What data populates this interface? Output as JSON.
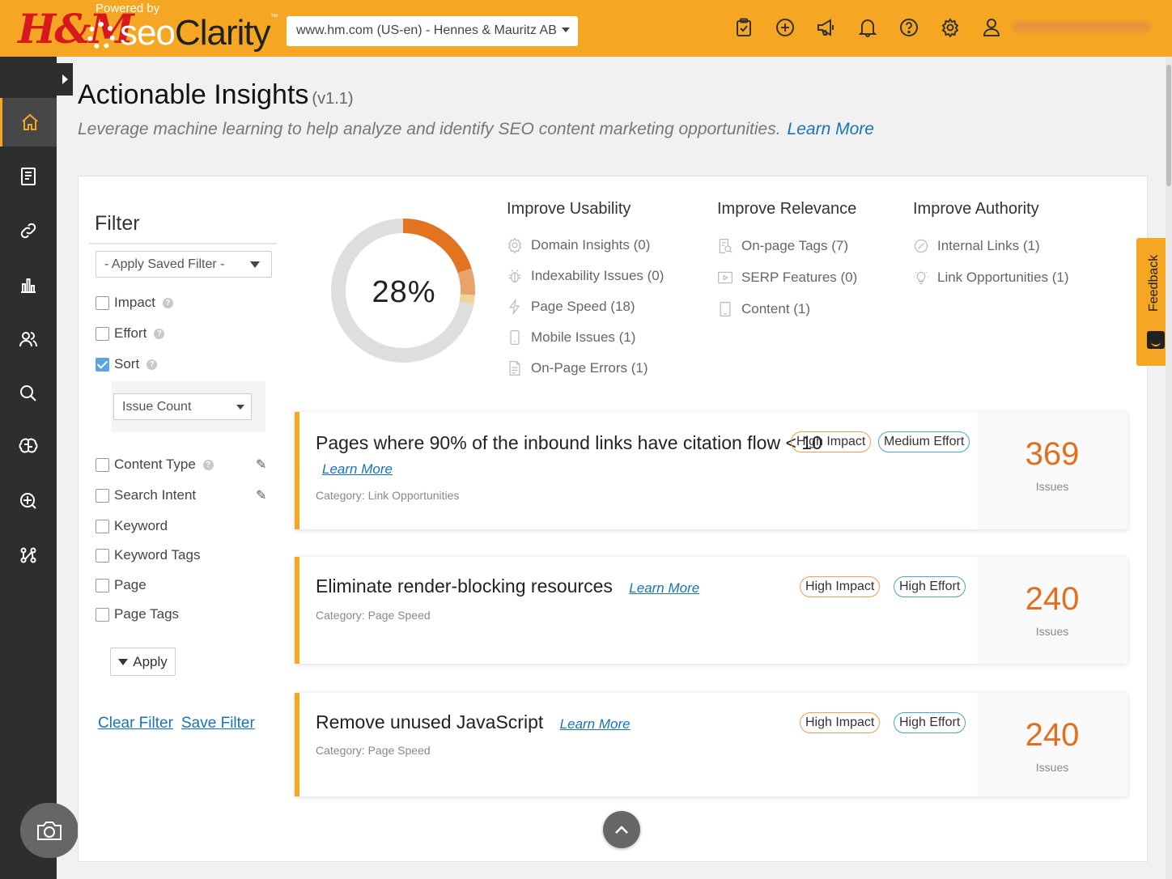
{
  "header": {
    "brand_logo": "H&M",
    "powered_by": "Powered by",
    "product_name_a": "seo",
    "product_name_b": "Clarity",
    "trademark": "™",
    "site_select": "www.hm.com (US-en) - Hennes & Mauritz AB",
    "icons": [
      "clipboard-check-icon",
      "plus-circle-icon",
      "megaphone-icon",
      "bell-icon",
      "help-circle-icon",
      "settings-icon",
      "user-icon"
    ]
  },
  "sidebar": {
    "items": [
      {
        "icon": "home-icon",
        "active": true
      },
      {
        "icon": "document-icon",
        "active": false
      },
      {
        "icon": "link-icon",
        "active": false
      },
      {
        "icon": "bar-chart-icon",
        "active": false
      },
      {
        "icon": "users-icon",
        "active": false
      },
      {
        "icon": "search-icon",
        "active": false
      },
      {
        "icon": "brain-icon",
        "active": false
      },
      {
        "icon": "research-grid-icon",
        "active": false
      },
      {
        "icon": "network-icon",
        "active": false
      }
    ],
    "screenshot_icon": "camera-icon"
  },
  "page": {
    "title": "Actionable Insights",
    "version": "(v1.1)",
    "subtitle": "Leverage machine learning to help analyze and identify SEO content marketing opportunities.",
    "learn_more": "Learn More"
  },
  "filter": {
    "title": "Filter",
    "saved_filter": "- Apply Saved Filter -",
    "options": [
      {
        "label": "Impact",
        "checked": false,
        "help": true
      },
      {
        "label": "Effort",
        "checked": false,
        "help": true
      },
      {
        "label": "Sort",
        "checked": true,
        "help": true
      }
    ],
    "sort_value": "Issue Count",
    "more_options": [
      {
        "label": "Content Type",
        "checked": false,
        "help": true,
        "editable": true
      },
      {
        "label": "Search Intent",
        "checked": false,
        "help": false,
        "editable": true
      },
      {
        "label": "Keyword",
        "checked": false
      },
      {
        "label": "Keyword Tags",
        "checked": false
      },
      {
        "label": "Page",
        "checked": false
      },
      {
        "label": "Page Tags",
        "checked": false
      }
    ],
    "apply": "Apply",
    "clear": "Clear Filter",
    "save": "Save Filter"
  },
  "donut": {
    "label": "28%",
    "percent": 28,
    "segments": [
      {
        "value": 20,
        "color": "#e2731f"
      },
      {
        "value": 6,
        "color": "#e8a26a"
      },
      {
        "value": 2,
        "color": "#f3d29c"
      }
    ],
    "track_color": "#dedede"
  },
  "categories": [
    {
      "heading": "Improve Usability",
      "items": [
        {
          "label": "Domain Insights (0)",
          "icon": "settings-icon"
        },
        {
          "label": "Indexability Issues (0)",
          "icon": "bug-icon"
        },
        {
          "label": "Page Speed (18)",
          "icon": "lightning-icon"
        },
        {
          "label": "Mobile Issues (1)",
          "icon": "mobile-icon"
        },
        {
          "label": "On-Page Errors (1)",
          "icon": "file-icon"
        }
      ]
    },
    {
      "heading": "Improve Relevance",
      "items": [
        {
          "label": "On-page Tags (7)",
          "icon": "tag-search-icon"
        },
        {
          "label": "SERP Features (0)",
          "icon": "play-box-icon"
        },
        {
          "label": "Content (1)",
          "icon": "tablet-icon"
        }
      ]
    },
    {
      "heading": "Improve Authority",
      "items": [
        {
          "label": "Internal Links (1)",
          "icon": "link-circle-icon"
        },
        {
          "label": "Link Opportunities (1)",
          "icon": "lightbulb-icon"
        }
      ]
    }
  ],
  "insights": [
    {
      "title": "Pages where 90% of the inbound links have citation flow < 10",
      "learn_more": "Learn More",
      "category": "Category: Link Opportunities",
      "impact": "High Impact",
      "effort": "Medium Effort",
      "count": "369",
      "count_label": "Issues"
    },
    {
      "title": "Eliminate render-blocking resources",
      "learn_more": "Learn More",
      "category": "Category: Page Speed",
      "impact": "High Impact",
      "effort": "High Effort",
      "count": "240",
      "count_label": "Issues"
    },
    {
      "title": "Remove unused JavaScript",
      "learn_more": "Learn More",
      "category": "Category: Page Speed",
      "impact": "High Impact",
      "effort": "High Effort",
      "count": "240",
      "count_label": "Issues"
    }
  ],
  "feedback": {
    "label": "Feedback"
  },
  "colors": {
    "brand": "#f5a623",
    "sidebar": "#2e2e2e",
    "link": "#1a73b8",
    "count": "#e07020"
  }
}
